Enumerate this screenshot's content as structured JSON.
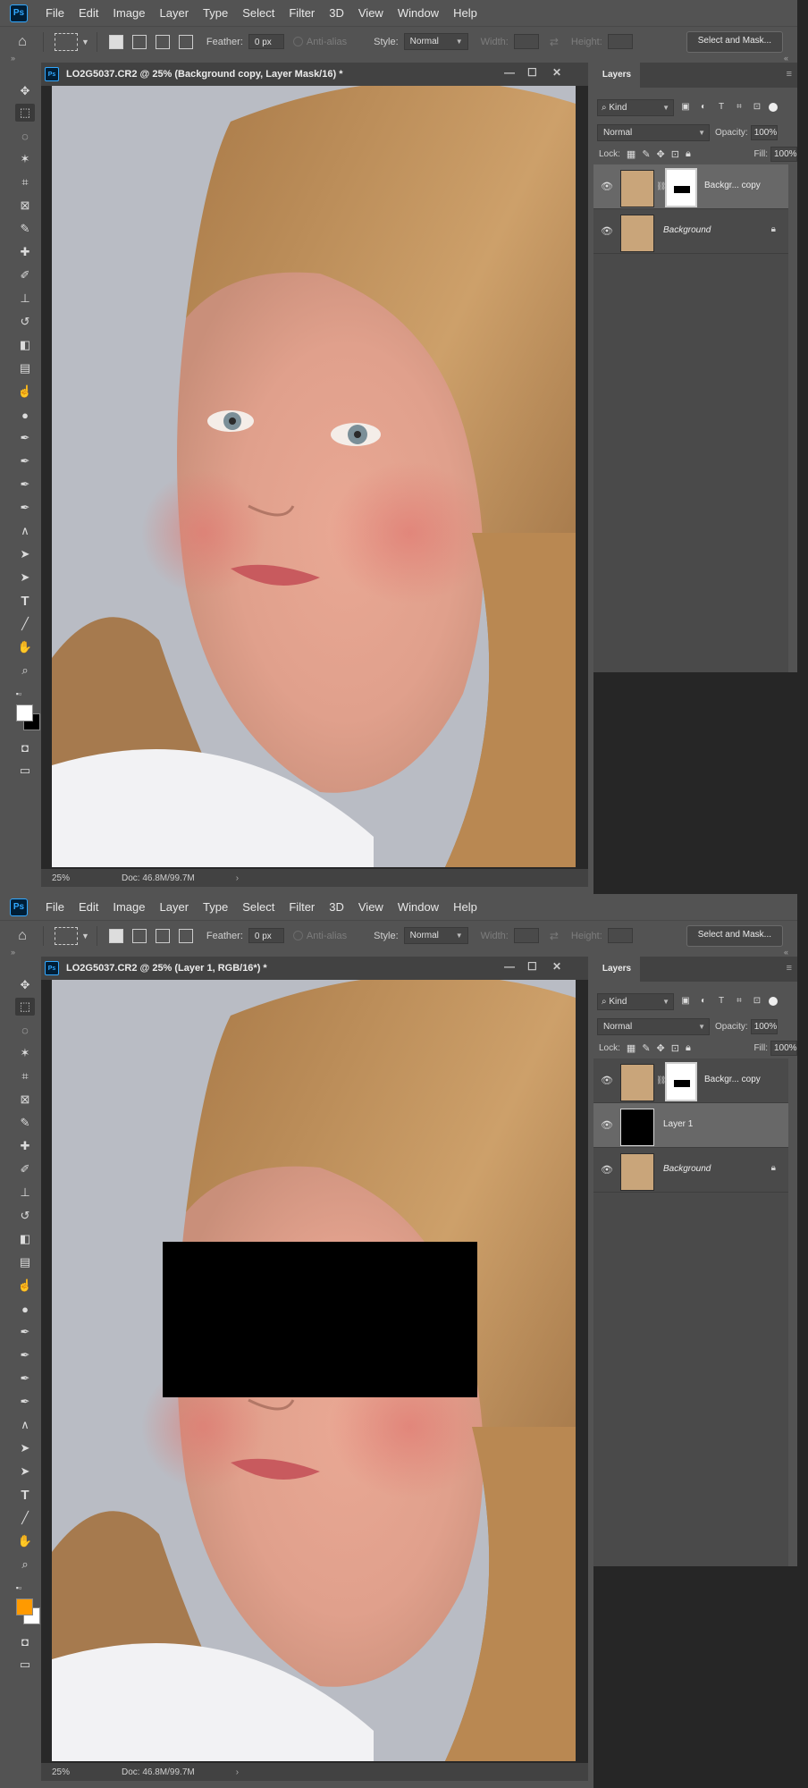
{
  "app": {
    "logo": "Ps"
  },
  "menu": [
    "File",
    "Edit",
    "Image",
    "Layer",
    "Type",
    "Select",
    "Filter",
    "3D",
    "View",
    "Window",
    "Help"
  ],
  "options": {
    "feather_label": "Feather:",
    "feather_value": "0 px",
    "antialias_label": "Anti-alias",
    "style_label": "Style:",
    "style_value": "Normal",
    "width_label": "Width:",
    "height_label": "Height:",
    "select_mask_button": "Select and Mask..."
  },
  "panel": {
    "tab": "Layers",
    "filter_kind": "Kind",
    "blend_mode": "Normal",
    "opacity_label": "Opacity:",
    "opacity_value": "100%",
    "lock_label": "Lock:",
    "fill_label": "Fill:",
    "fill_value": "100%"
  },
  "screens": [
    {
      "doc_title": "LO2G5037.CR2 @ 25% (Background copy, Layer Mask/16) *",
      "zoom": "25%",
      "doc_size": "Doc: 46.8M/99.7M",
      "foreground_color": "#ffffff",
      "background_color": "#000000",
      "layers": [
        {
          "name": "Backgr... copy",
          "selected": true,
          "has_mask": true,
          "locked": false
        },
        {
          "name": "Background",
          "selected": false,
          "has_mask": false,
          "locked": true
        }
      ]
    },
    {
      "doc_title": "LO2G5037.CR2 @ 25% (Layer 1, RGB/16*) *",
      "zoom": "25%",
      "doc_size": "Doc: 46.8M/99.7M",
      "foreground_color": "#ff9a00",
      "background_color": "#ffffff",
      "layers": [
        {
          "name": "Backgr... copy",
          "selected": false,
          "has_mask": true,
          "locked": false
        },
        {
          "name": "Layer 1",
          "selected": true,
          "has_mask": false,
          "locked": false
        },
        {
          "name": "Background",
          "selected": false,
          "has_mask": false,
          "locked": true
        }
      ]
    }
  ]
}
